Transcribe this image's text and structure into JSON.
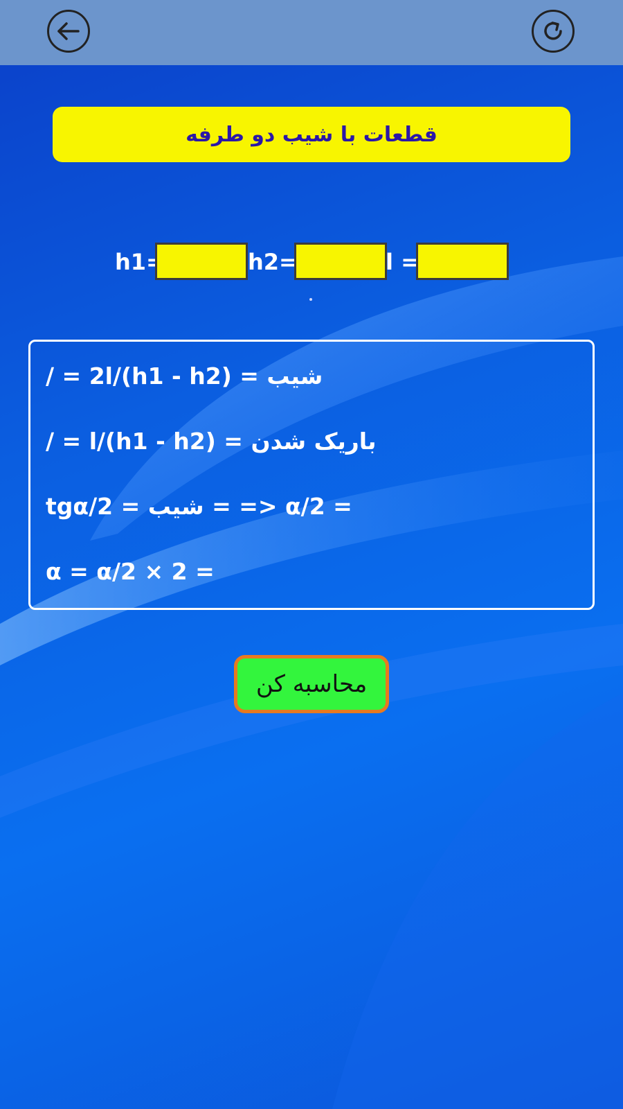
{
  "colors": {
    "topbar": "#6c95cc",
    "background": "#0a56d6",
    "title_bg": "#f8f500",
    "title_text": "#2b17a8",
    "input_bg": "#f8f500",
    "result_text": "#ffffff",
    "button_bg": "#33f53d",
    "button_border": "#e87a1f"
  },
  "topbar": {
    "back_icon": "arrow-left-icon",
    "refresh_icon": "refresh-icon"
  },
  "title": "قطعات با شیب دو طرفه",
  "inputs": {
    "h1_label": "h1=",
    "h1_value": "",
    "h2_label": "h2=",
    "h2_value": "",
    "l_label": "l =",
    "l_value": ""
  },
  "results": {
    "line1": "شیب = (h1 - h2)/2l = /",
    "line2": "باریک شدن = (h1 - h2)/l = /",
    "line3": "tgα/2 = شیب = => α/2 =",
    "line4": "α = α/2 × 2 ="
  },
  "calculate_button": "محاسبه کن"
}
